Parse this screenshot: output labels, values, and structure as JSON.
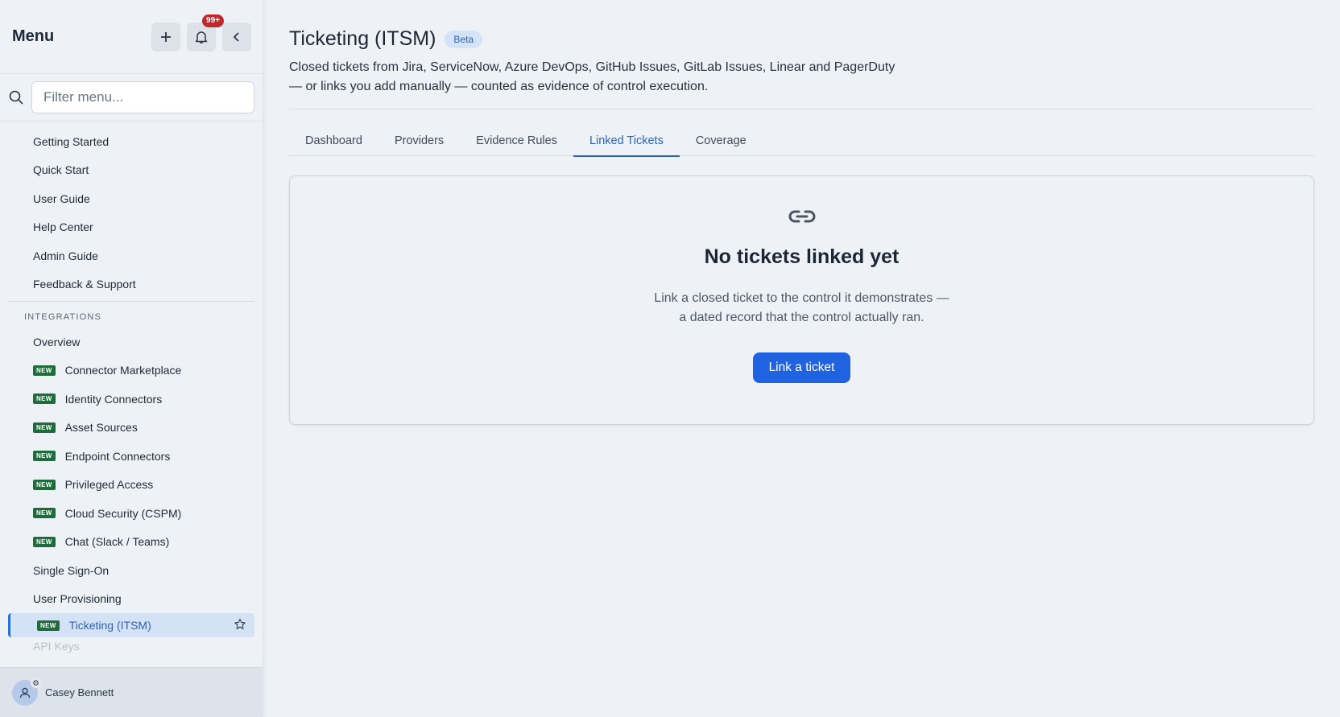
{
  "sidebar": {
    "title": "Menu",
    "notification_count": "99+",
    "search_placeholder": "Filter menu...",
    "items_top": [
      {
        "label": "Getting Started"
      },
      {
        "label": "Quick Start"
      },
      {
        "label": "User Guide"
      },
      {
        "label": "Help Center"
      },
      {
        "label": "Admin Guide"
      },
      {
        "label": "Feedback & Support"
      }
    ],
    "section_integrations": "INTEGRATIONS",
    "items_integrations": [
      {
        "label": "Overview",
        "new": false
      },
      {
        "label": "Connector Marketplace",
        "new": true
      },
      {
        "label": "Identity Connectors",
        "new": true
      },
      {
        "label": "Asset Sources",
        "new": true
      },
      {
        "label": "Endpoint Connectors",
        "new": true
      },
      {
        "label": "Privileged Access",
        "new": true
      },
      {
        "label": "Cloud Security (CSPM)",
        "new": true
      },
      {
        "label": "Chat (Slack / Teams)",
        "new": true
      },
      {
        "label": "Single Sign-On",
        "new": false
      },
      {
        "label": "User Provisioning",
        "new": false
      }
    ],
    "active_item": {
      "label": "Ticketing (ITSM)",
      "new": true
    },
    "partial_item": "API Keys",
    "new_badge": "NEW",
    "user_name": "Casey Bennett"
  },
  "main": {
    "title": "Ticketing (ITSM)",
    "badge": "Beta",
    "description_line1": "Closed tickets from Jira, ServiceNow, Azure DevOps, GitHub Issues, GitLab Issues, Linear and PagerDuty",
    "description_line2": "— or links you add manually — counted as evidence of control execution.",
    "tabs": [
      {
        "label": "Dashboard"
      },
      {
        "label": "Providers"
      },
      {
        "label": "Evidence Rules"
      },
      {
        "label": "Linked Tickets"
      },
      {
        "label": "Coverage"
      }
    ],
    "active_tab": "Linked Tickets",
    "empty_state": {
      "title": "No tickets linked yet",
      "text_line1": "Link a closed ticket to the control it demonstrates —",
      "text_line2": "a dated record that the control actually ran.",
      "button": "Link a ticket"
    }
  },
  "colors": {
    "accent": "#2c63b8",
    "primary_button": "#1f63e0",
    "badge_new": "#1e6b3b",
    "notification": "#c0282b"
  }
}
